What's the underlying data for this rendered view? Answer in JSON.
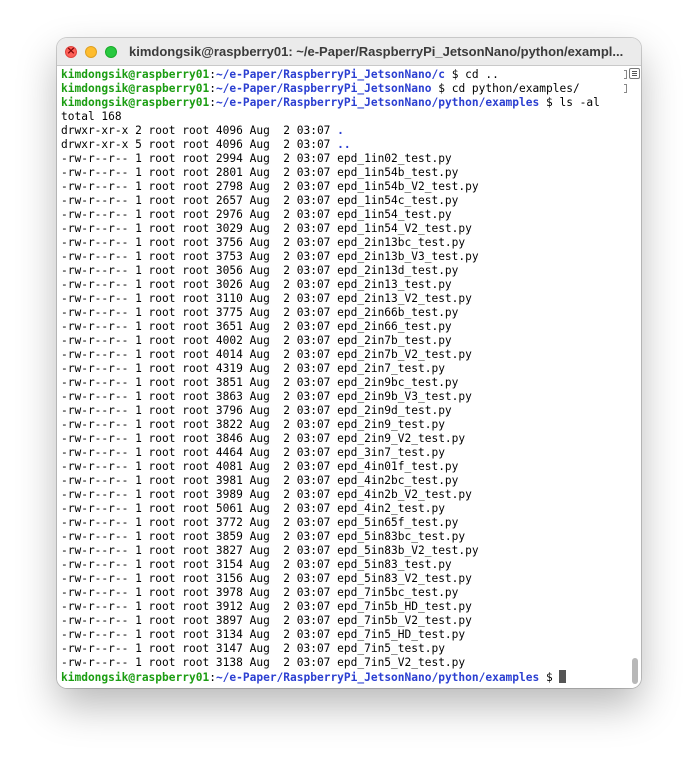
{
  "window": {
    "title": "kimdongsik@raspberry01: ~/e-Paper/RaspberryPi_JetsonNano/python/exampl..."
  },
  "prompt": {
    "user_host": "kimdongsik@raspberry01",
    "colon": ":",
    "symbol": " $ "
  },
  "commands": [
    {
      "path": "~/e-Paper/RaspberryPi_JetsonNano/c",
      "cmd": "cd .."
    },
    {
      "path": "~/e-Paper/RaspberryPi_JetsonNano",
      "cmd": "cd python/examples/"
    },
    {
      "path": "~/e-Paper/RaspberryPi_JetsonNano/python/examples",
      "cmd": "ls -al"
    }
  ],
  "ls_output": {
    "total": "total 168",
    "dirs": [
      {
        "info": "drwxr-xr-x 2 root root 4096 Aug  2 03:07 ",
        "name": "."
      },
      {
        "info": "drwxr-xr-x 5 root root 4096 Aug  2 03:07 ",
        "name": ".."
      }
    ],
    "files": [
      {
        "info": "-rw-r--r-- 1 root root 2994 Aug  2 03:07 ",
        "name": "epd_1in02_test.py"
      },
      {
        "info": "-rw-r--r-- 1 root root 2801 Aug  2 03:07 ",
        "name": "epd_1in54b_test.py"
      },
      {
        "info": "-rw-r--r-- 1 root root 2798 Aug  2 03:07 ",
        "name": "epd_1in54b_V2_test.py"
      },
      {
        "info": "-rw-r--r-- 1 root root 2657 Aug  2 03:07 ",
        "name": "epd_1in54c_test.py"
      },
      {
        "info": "-rw-r--r-- 1 root root 2976 Aug  2 03:07 ",
        "name": "epd_1in54_test.py"
      },
      {
        "info": "-rw-r--r-- 1 root root 3029 Aug  2 03:07 ",
        "name": "epd_1in54_V2_test.py"
      },
      {
        "info": "-rw-r--r-- 1 root root 3756 Aug  2 03:07 ",
        "name": "epd_2in13bc_test.py"
      },
      {
        "info": "-rw-r--r-- 1 root root 3753 Aug  2 03:07 ",
        "name": "epd_2in13b_V3_test.py"
      },
      {
        "info": "-rw-r--r-- 1 root root 3056 Aug  2 03:07 ",
        "name": "epd_2in13d_test.py"
      },
      {
        "info": "-rw-r--r-- 1 root root 3026 Aug  2 03:07 ",
        "name": "epd_2in13_test.py"
      },
      {
        "info": "-rw-r--r-- 1 root root 3110 Aug  2 03:07 ",
        "name": "epd_2in13_V2_test.py"
      },
      {
        "info": "-rw-r--r-- 1 root root 3775 Aug  2 03:07 ",
        "name": "epd_2in66b_test.py"
      },
      {
        "info": "-rw-r--r-- 1 root root 3651 Aug  2 03:07 ",
        "name": "epd_2in66_test.py"
      },
      {
        "info": "-rw-r--r-- 1 root root 4002 Aug  2 03:07 ",
        "name": "epd_2in7b_test.py"
      },
      {
        "info": "-rw-r--r-- 1 root root 4014 Aug  2 03:07 ",
        "name": "epd_2in7b_V2_test.py"
      },
      {
        "info": "-rw-r--r-- 1 root root 4319 Aug  2 03:07 ",
        "name": "epd_2in7_test.py"
      },
      {
        "info": "-rw-r--r-- 1 root root 3851 Aug  2 03:07 ",
        "name": "epd_2in9bc_test.py"
      },
      {
        "info": "-rw-r--r-- 1 root root 3863 Aug  2 03:07 ",
        "name": "epd_2in9b_V3_test.py"
      },
      {
        "info": "-rw-r--r-- 1 root root 3796 Aug  2 03:07 ",
        "name": "epd_2in9d_test.py"
      },
      {
        "info": "-rw-r--r-- 1 root root 3822 Aug  2 03:07 ",
        "name": "epd_2in9_test.py"
      },
      {
        "info": "-rw-r--r-- 1 root root 3846 Aug  2 03:07 ",
        "name": "epd_2in9_V2_test.py"
      },
      {
        "info": "-rw-r--r-- 1 root root 4464 Aug  2 03:07 ",
        "name": "epd_3in7_test.py"
      },
      {
        "info": "-rw-r--r-- 1 root root 4081 Aug  2 03:07 ",
        "name": "epd_4in01f_test.py"
      },
      {
        "info": "-rw-r--r-- 1 root root 3981 Aug  2 03:07 ",
        "name": "epd_4in2bc_test.py"
      },
      {
        "info": "-rw-r--r-- 1 root root 3989 Aug  2 03:07 ",
        "name": "epd_4in2b_V2_test.py"
      },
      {
        "info": "-rw-r--r-- 1 root root 5061 Aug  2 03:07 ",
        "name": "epd_4in2_test.py"
      },
      {
        "info": "-rw-r--r-- 1 root root 3772 Aug  2 03:07 ",
        "name": "epd_5in65f_test.py"
      },
      {
        "info": "-rw-r--r-- 1 root root 3859 Aug  2 03:07 ",
        "name": "epd_5in83bc_test.py"
      },
      {
        "info": "-rw-r--r-- 1 root root 3827 Aug  2 03:07 ",
        "name": "epd_5in83b_V2_test.py"
      },
      {
        "info": "-rw-r--r-- 1 root root 3154 Aug  2 03:07 ",
        "name": "epd_5in83_test.py"
      },
      {
        "info": "-rw-r--r-- 1 root root 3156 Aug  2 03:07 ",
        "name": "epd_5in83_V2_test.py"
      },
      {
        "info": "-rw-r--r-- 1 root root 3978 Aug  2 03:07 ",
        "name": "epd_7in5bc_test.py"
      },
      {
        "info": "-rw-r--r-- 1 root root 3912 Aug  2 03:07 ",
        "name": "epd_7in5b_HD_test.py"
      },
      {
        "info": "-rw-r--r-- 1 root root 3897 Aug  2 03:07 ",
        "name": "epd_7in5b_V2_test.py"
      },
      {
        "info": "-rw-r--r-- 1 root root 3134 Aug  2 03:07 ",
        "name": "epd_7in5_HD_test.py"
      },
      {
        "info": "-rw-r--r-- 1 root root 3147 Aug  2 03:07 ",
        "name": "epd_7in5_test.py"
      },
      {
        "info": "-rw-r--r-- 1 root root 3138 Aug  2 03:07 ",
        "name": "epd_7in5_V2_test.py"
      }
    ]
  },
  "final_prompt": {
    "path": "~/e-Paper/RaspberryPi_JetsonNano/python/examples"
  },
  "colors": {
    "prompt_user": "#1b9d12",
    "prompt_path": "#2b3fd1",
    "close": "#fe5f57",
    "minimize": "#febc2e",
    "maximize": "#28c840"
  },
  "icons": [
    "close-icon",
    "minimize-icon",
    "maximize-icon",
    "scroll-menu-icon"
  ]
}
